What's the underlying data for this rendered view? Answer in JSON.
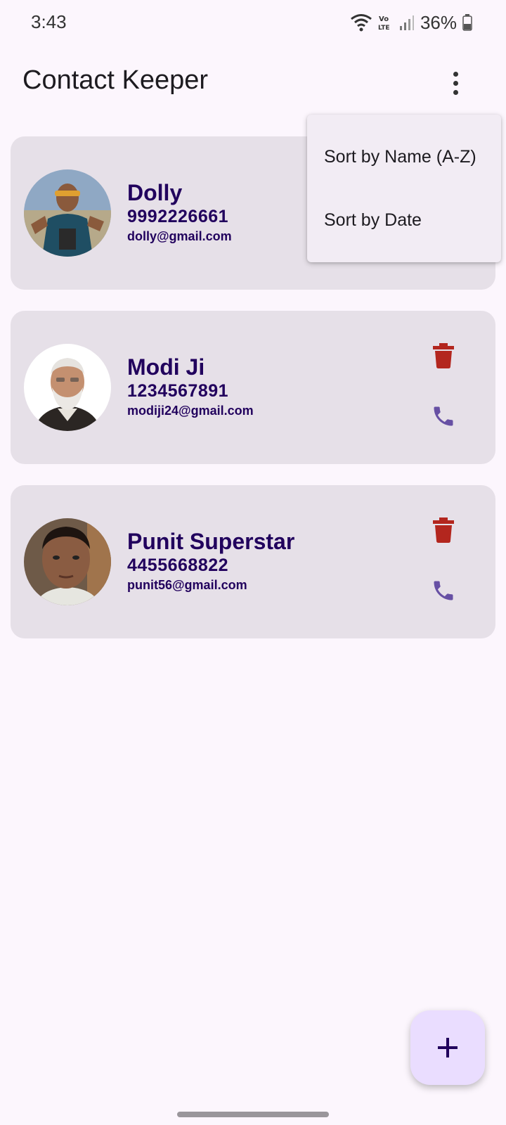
{
  "status_bar": {
    "time": "3:43",
    "battery_text": "36%",
    "icons": [
      "wifi-icon",
      "volte-icon",
      "signal-icon",
      "battery-icon"
    ]
  },
  "app_bar": {
    "title": "Contact Keeper",
    "overflow_icon": "more-vert-icon"
  },
  "menu": {
    "items": [
      {
        "label": "Sort by Name (A-Z)"
      },
      {
        "label": "Sort by Date"
      }
    ]
  },
  "contacts": [
    {
      "name": "Dolly",
      "phone": "9992226661",
      "email": "dolly@gmail.com"
    },
    {
      "name": "Modi Ji",
      "phone": "1234567891",
      "email": "modiji24@gmail.com"
    },
    {
      "name": "Punit Superstar",
      "phone": "4455668822",
      "email": "punit56@gmail.com"
    }
  ],
  "fab": {
    "icon": "add-icon"
  },
  "colors": {
    "background": "#fcf6fd",
    "card": "#e6e0e8",
    "text_primary": "#21005d",
    "delete": "#b3261e",
    "call": "#6750a4",
    "fab": "#eaddff"
  }
}
